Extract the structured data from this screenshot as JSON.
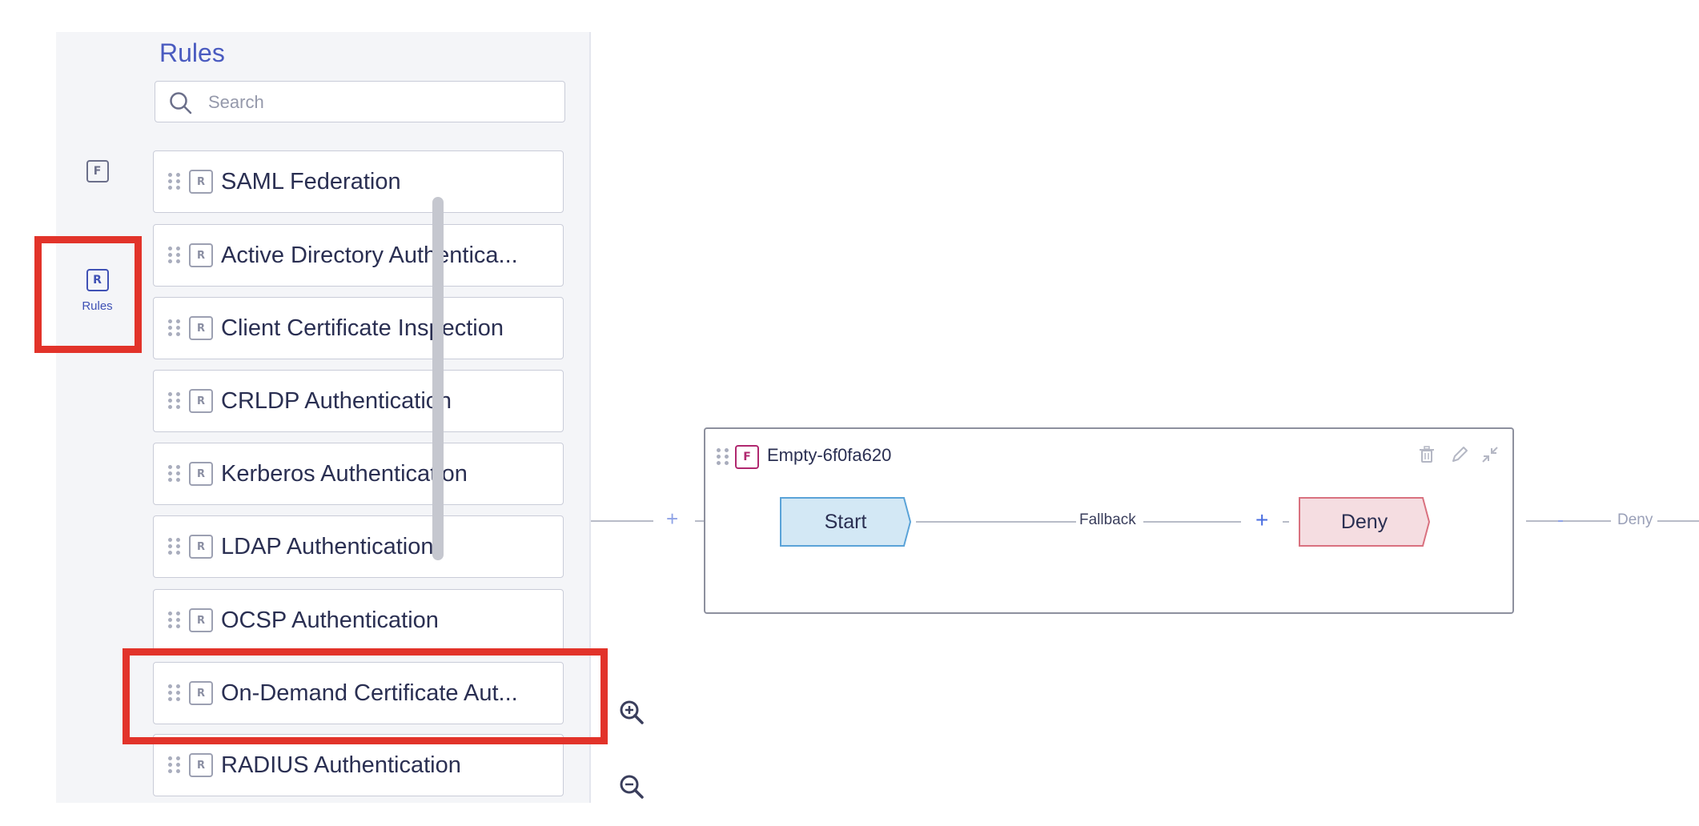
{
  "sidebar": {
    "rail": {
      "flow_icon": "F",
      "rules_icon": "R",
      "rules_label": "Rules"
    },
    "panel": {
      "title": "Rules",
      "search_placeholder": "Search",
      "items": [
        {
          "icon": "R",
          "label": "SAML Federation"
        },
        {
          "icon": "R",
          "label": "Active Directory Authentica..."
        },
        {
          "icon": "R",
          "label": "Client Certificate Inspection"
        },
        {
          "icon": "R",
          "label": "CRLDP Authentication"
        },
        {
          "icon": "R",
          "label": "Kerberos Authentication"
        },
        {
          "icon": "R",
          "label": "LDAP Authentication"
        },
        {
          "icon": "R",
          "label": "OCSP Authentication"
        },
        {
          "icon": "R",
          "label": "On-Demand Certificate Aut..."
        },
        {
          "icon": "R",
          "label": "RADIUS Authentication"
        }
      ]
    }
  },
  "canvas": {
    "zoom_in_icon": "zoom-in-icon",
    "zoom_out_icon": "zoom-out-icon",
    "flow": {
      "icon": "F",
      "title": "Empty-6f0fa620",
      "start_label": "Start",
      "fallback_label": "Fallback",
      "deny_label": "Deny",
      "outer_deny_label": "Deny"
    }
  },
  "colors": {
    "accent": "#3f51b5",
    "highlight": "#e2332a",
    "start_fill": "#d3e8f5",
    "start_stroke": "#5aa3d8",
    "deny_fill": "#f5dde1",
    "deny_stroke": "#d9717f",
    "flow_icon": "#b0286f"
  }
}
